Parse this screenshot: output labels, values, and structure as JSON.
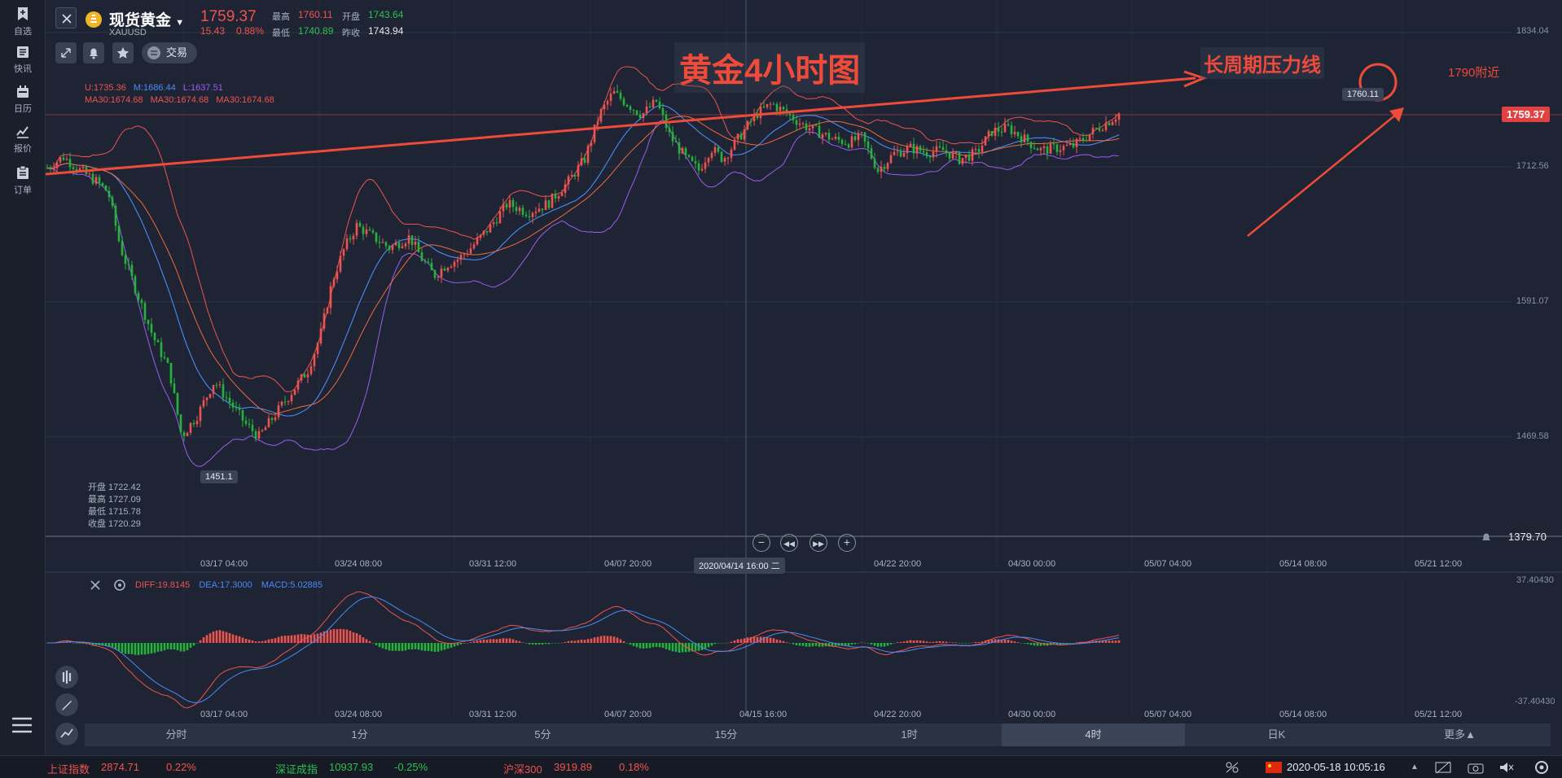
{
  "sidebar": {
    "items": [
      {
        "label": "自选",
        "icon": "bookmark-icon"
      },
      {
        "label": "快讯",
        "icon": "news-icon"
      },
      {
        "label": "日历",
        "icon": "calendar-icon"
      },
      {
        "label": "报价",
        "icon": "quote-chart-icon"
      },
      {
        "label": "订单",
        "icon": "clipboard-icon"
      }
    ]
  },
  "header": {
    "name": "现货黄金",
    "code": "XAUUSD",
    "price": "1759.37",
    "change": "15.43",
    "change_pct": "0.88%",
    "high_label": "最高",
    "high": "1760.11",
    "open_label": "开盘",
    "open": "1743.64",
    "low_label": "最低",
    "low": "1740.89",
    "prev_label": "昨收",
    "prev": "1743.94",
    "trade_label": "交易"
  },
  "boll": {
    "u": "U:1735.36",
    "m": "M:1686.44",
    "l": "L:1637.51"
  },
  "ma": {
    "a": "MA30:1674.68",
    "b": "MA30:1674.68",
    "c": "MA30:1674.68"
  },
  "annotations": {
    "title": "黄金4小时图",
    "resistance": "长周期压力线",
    "target": "1790附近"
  },
  "price_axis": [
    "1834.04",
    "1712.56",
    "1591.07",
    "1469.58"
  ],
  "current_price_tag": "1759.37",
  "high_pill": "1760.11",
  "low_pill": "1451.1",
  "crosshair_date": "2020/04/14 16:00 二",
  "alert_price": "1379.70",
  "ohlc_panel": {
    "open": "开盘 1722.42",
    "high": "最高 1727.09",
    "low": "最低 1715.78",
    "close": "收盘 1720.29"
  },
  "x_labels": [
    "03/17 04:00",
    "03/24 08:00",
    "03/31 12:00",
    "04/07 20:00",
    "04/15 16:00",
    "04/22 20:00",
    "04/30 00:00",
    "05/07 04:00",
    "05/14 08:00",
    "05/21 12:00"
  ],
  "macd": {
    "diff": "DIFF:19.8145",
    "dea": "DEA:17.3000",
    "macd": "MACD:5.02885",
    "axis_top": "37.40430",
    "axis_bottom": "-37.40430"
  },
  "timeframes": [
    "分时",
    "1分",
    "5分",
    "15分",
    "1时",
    "4时",
    "日K",
    "更多▲"
  ],
  "active_timeframe": "4时",
  "ticker": [
    {
      "name": "上证指数",
      "value": "2874.71",
      "chg": "0.22%",
      "color": "#ef5350"
    },
    {
      "name": "深证成指",
      "value": "10937.93",
      "chg": "-0.25%",
      "color": "#2fbf4f"
    },
    {
      "name": "沪深300",
      "value": "3919.89",
      "chg": "0.18%",
      "color": "#ef5350"
    }
  ],
  "clock": "2020-05-18 10:05:16",
  "colors": {
    "up": "#ef5350",
    "down": "#26b33b",
    "boll_u": "#ef5350",
    "boll_m": "#4a8bf5",
    "boll_l": "#9d5cf0",
    "accent": "#ef4b3a"
  }
}
